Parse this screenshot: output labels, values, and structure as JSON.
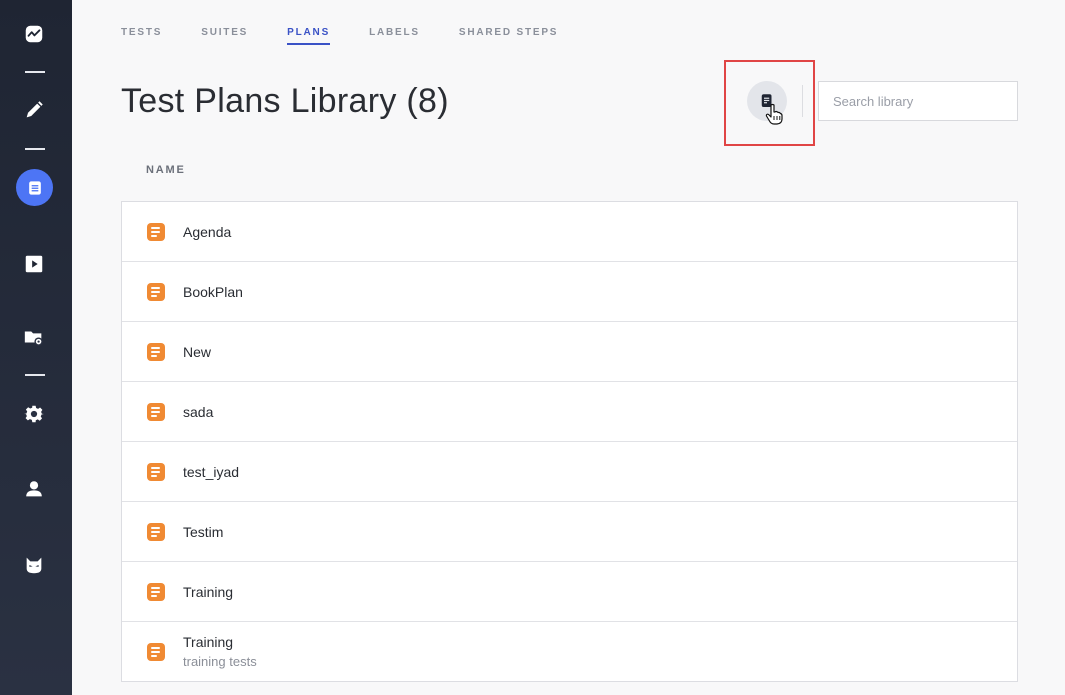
{
  "sidebar": {
    "icons": [
      "activity-icon",
      "pencil-icon",
      "document-list-icon",
      "play-icon",
      "folder-settings-icon",
      "gear-icon",
      "user-icon",
      "cat-logo-icon"
    ]
  },
  "tabs": [
    {
      "label": "TESTS",
      "active": false
    },
    {
      "label": "SUITES",
      "active": false
    },
    {
      "label": "PLANS",
      "active": true
    },
    {
      "label": "LABELS",
      "active": false
    },
    {
      "label": "SHARED STEPS",
      "active": false
    }
  ],
  "page": {
    "title": "Test Plans Library (8)"
  },
  "search": {
    "placeholder": "Search library",
    "value": ""
  },
  "table": {
    "column_header": "NAME",
    "rows": [
      {
        "name": "Agenda",
        "description": ""
      },
      {
        "name": "BookPlan",
        "description": ""
      },
      {
        "name": "New",
        "description": ""
      },
      {
        "name": "sada",
        "description": ""
      },
      {
        "name": "test_iyad",
        "description": ""
      },
      {
        "name": "Testim",
        "description": ""
      },
      {
        "name": "Training",
        "description": ""
      },
      {
        "name": "Training",
        "description": "training tests"
      }
    ]
  },
  "colors": {
    "accent": "#3a52c6",
    "sidebar_active": "#4d75f5",
    "plan_icon": "#f08a33",
    "highlight": "#e04545"
  }
}
